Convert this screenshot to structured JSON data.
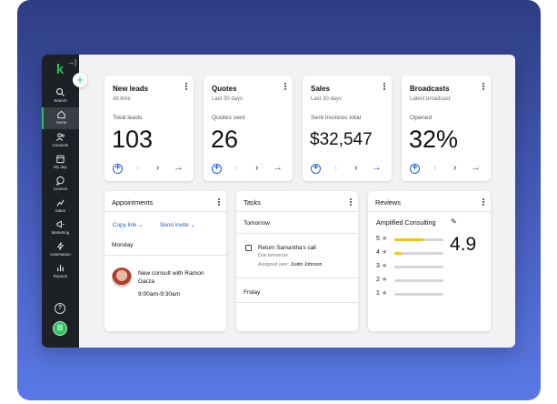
{
  "sidebar": {
    "logo": "k",
    "items": [
      {
        "label": "Search",
        "icon": "search-icon"
      },
      {
        "label": "Home",
        "icon": "home-icon",
        "active": true
      },
      {
        "label": "Contacts",
        "icon": "contacts-icon"
      },
      {
        "label": "My day",
        "icon": "calendar-icon"
      },
      {
        "label": "Convos",
        "icon": "chat-icon"
      },
      {
        "label": "Sales",
        "icon": "sales-icon"
      },
      {
        "label": "Marketing",
        "icon": "megaphone-icon"
      },
      {
        "label": "Automation",
        "icon": "lightning-icon"
      },
      {
        "label": "Reports",
        "icon": "bar-chart-icon"
      }
    ],
    "help": "?"
  },
  "stats": [
    {
      "title": "New leads",
      "sub": "All time",
      "label": "Total leads",
      "value": "103"
    },
    {
      "title": "Quotes",
      "sub": "Last 30 days",
      "label": "Quotes sent",
      "value": "26"
    },
    {
      "title": "Sales",
      "sub": "Last 30 days",
      "label": "Sent invoices total",
      "value": "$32,547"
    },
    {
      "title": "Broadcasts",
      "sub": "Latest broadcast",
      "label": "Opened",
      "value": "32%"
    }
  ],
  "appointments": {
    "title": "Appointments",
    "copy_link": "Copy link",
    "send_invite": "Send invite",
    "day": "Monday",
    "event_title": "New consult with Ramon Garza",
    "event_time": "9:00am-9:30am"
  },
  "tasks": {
    "title": "Tasks",
    "group1": "Tomorrow",
    "task_title": "Return Samantha's call",
    "task_due": "Due tomorrow",
    "assigned_label": "Assigned user:",
    "assigned_user": "Justin Johnson",
    "group2": "Friday"
  },
  "reviews": {
    "title": "Reviews",
    "business": "Amplified Consulting",
    "average": "4.9",
    "rows": [
      {
        "star": "5",
        "fraction": 0.6
      },
      {
        "star": "4",
        "fraction": 0.15
      },
      {
        "star": "3",
        "fraction": 0
      },
      {
        "star": "2",
        "fraction": 0
      },
      {
        "star": "1",
        "fraction": 0
      }
    ]
  },
  "colors": {
    "accent": "#28c15b",
    "link": "#1f62c9",
    "sidebar": "#1d2024",
    "star": "#f3c31b"
  }
}
